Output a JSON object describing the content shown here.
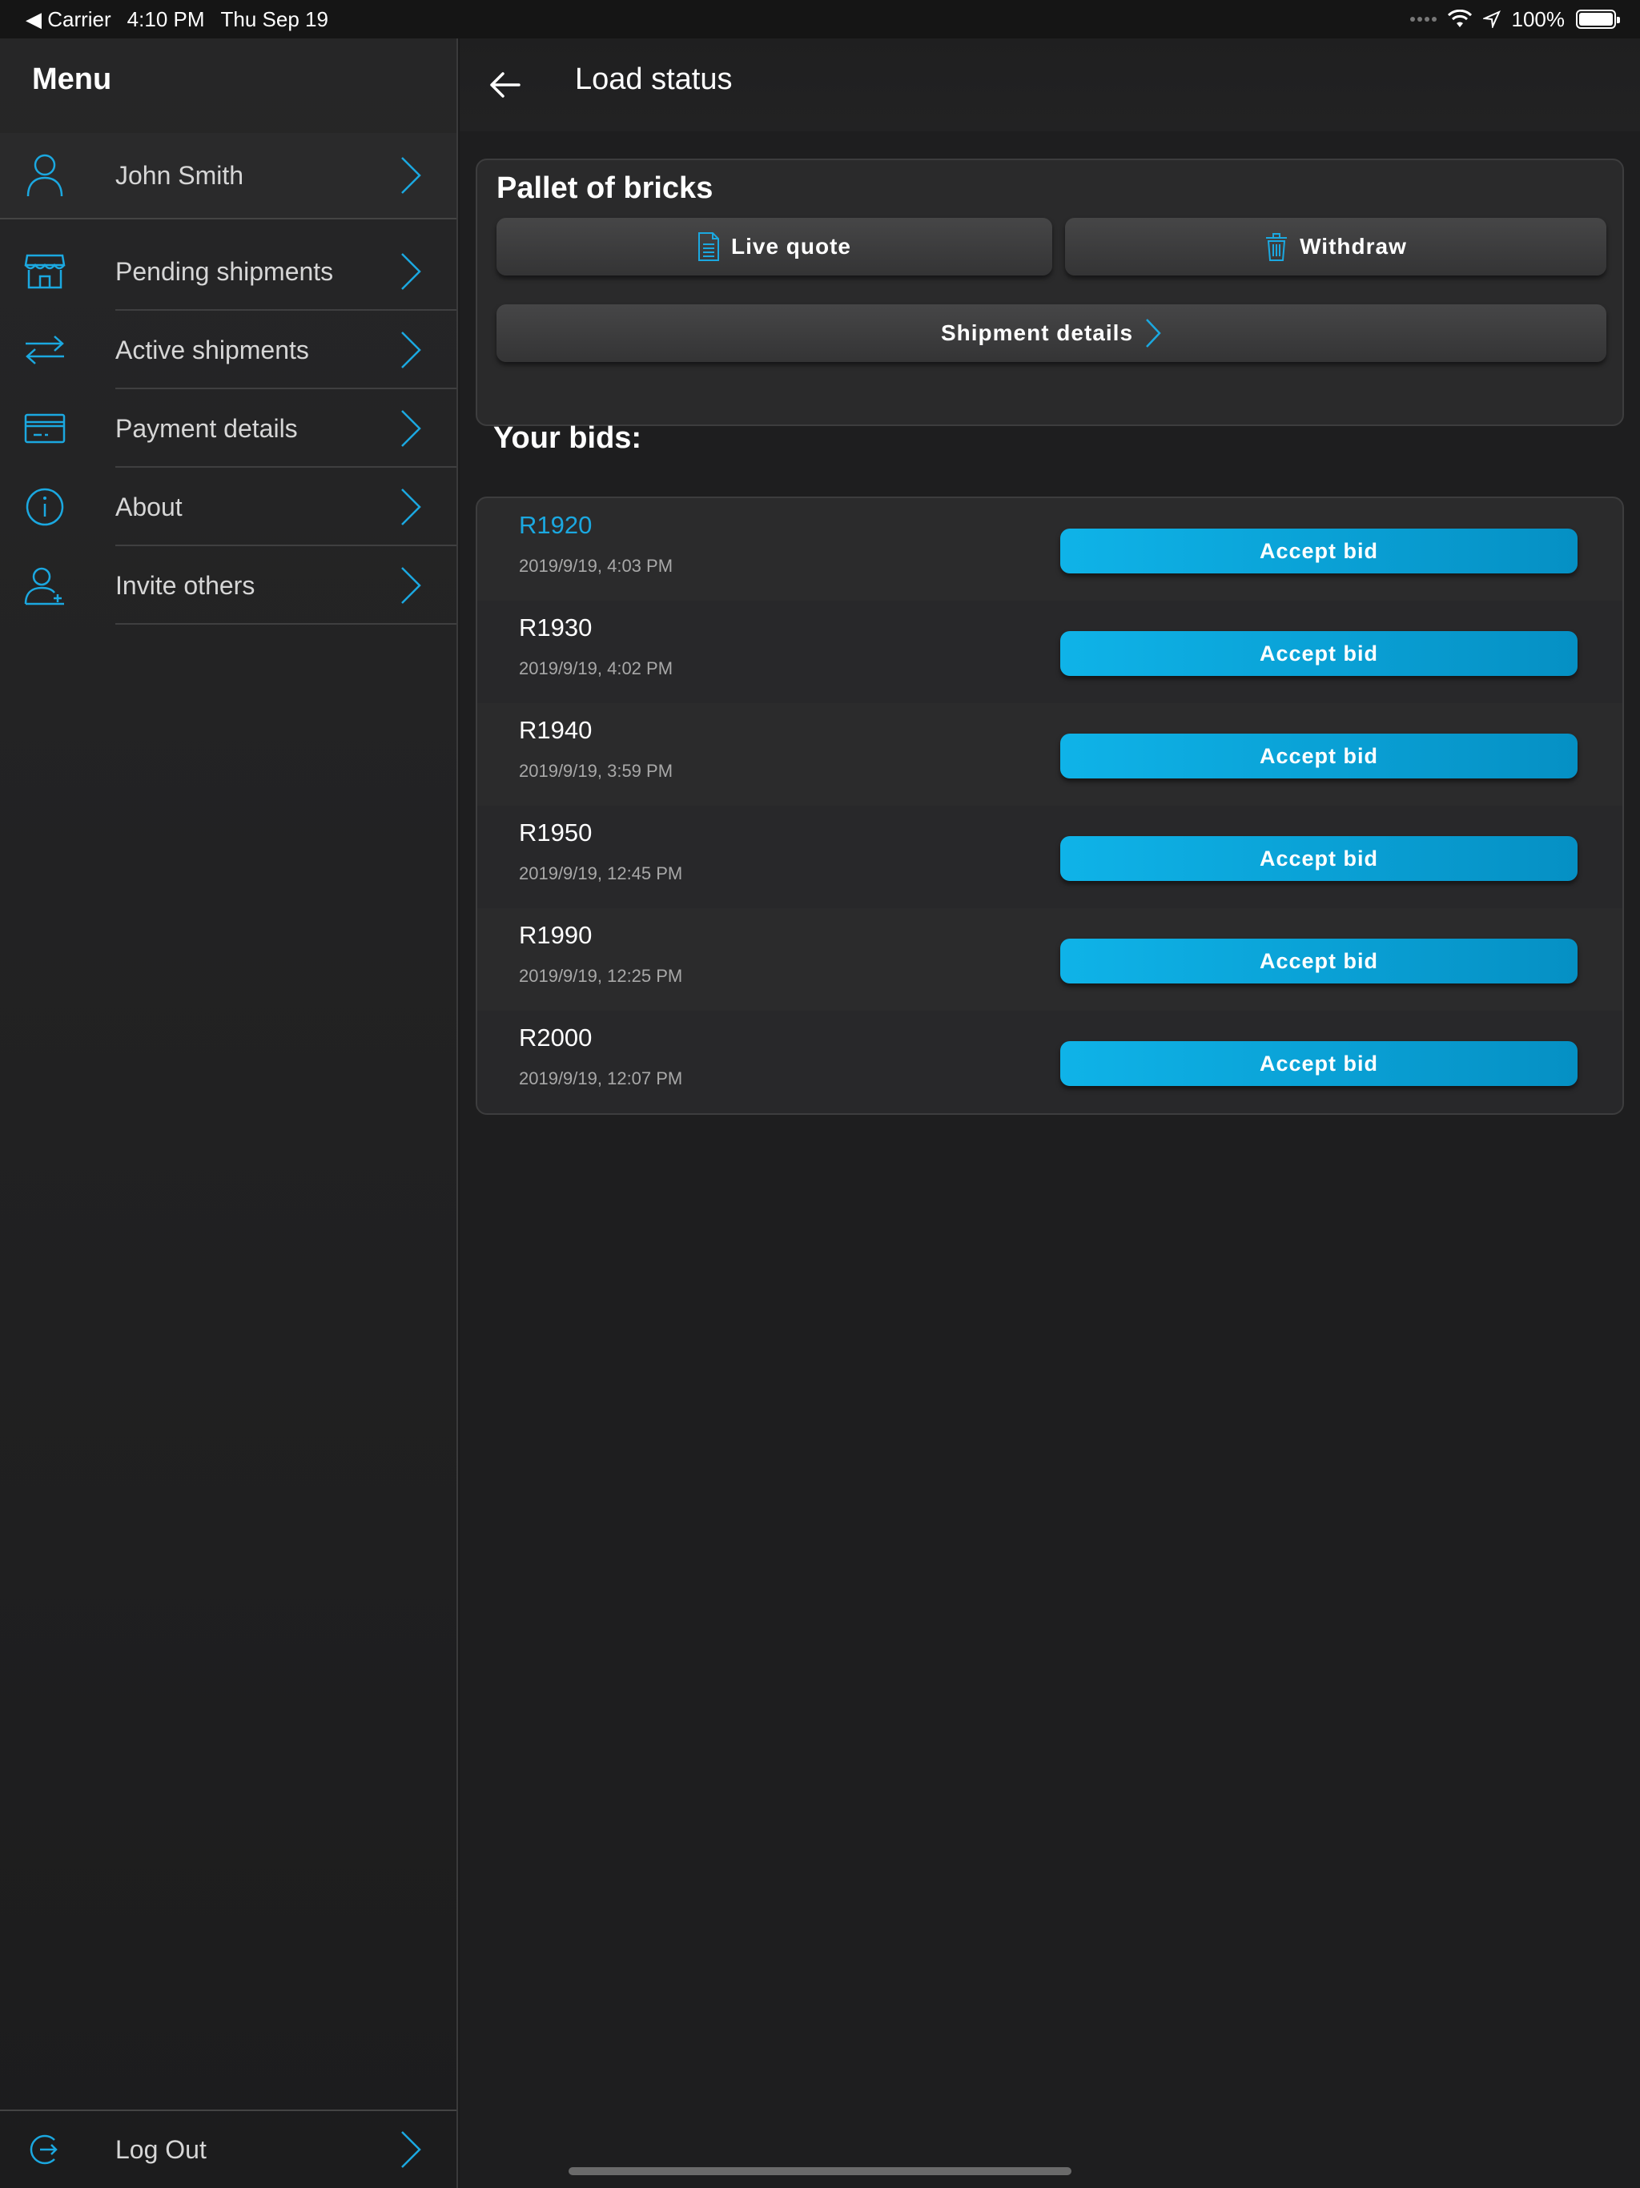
{
  "status_bar": {
    "carrier": "◀ Carrier",
    "time": "4:10 PM",
    "date": "Thu Sep 19",
    "battery": "100%"
  },
  "sidebar": {
    "title": "Menu",
    "profile": {
      "name": "John Smith",
      "icon": "user-icon"
    },
    "items": [
      {
        "label": "Pending shipments",
        "icon": "storefront-icon"
      },
      {
        "label": "Active shipments",
        "icon": "arrows-exchange-icon"
      },
      {
        "label": "Payment details",
        "icon": "credit-card-icon"
      },
      {
        "label": "About",
        "icon": "info-icon"
      },
      {
        "label": "Invite others",
        "icon": "add-user-icon"
      }
    ],
    "logout": {
      "label": "Log Out",
      "icon": "logout-icon"
    }
  },
  "header": {
    "title": "Load status"
  },
  "load": {
    "title": "Pallet of bricks",
    "live_quote_label": "Live quote",
    "withdraw_label": "Withdraw",
    "shipment_details_label": "Shipment details"
  },
  "bids": {
    "heading": "Your bids:",
    "accept_label": "Accept bid",
    "items": [
      {
        "amount": "R1920",
        "date": "2019/9/19, 4:03 PM"
      },
      {
        "amount": "R1930",
        "date": "2019/9/19, 4:02 PM"
      },
      {
        "amount": "R1940",
        "date": "2019/9/19, 3:59 PM"
      },
      {
        "amount": "R1950",
        "date": "2019/9/19, 12:45 PM"
      },
      {
        "amount": "R1990",
        "date": "2019/9/19, 12:25 PM"
      },
      {
        "amount": "R2000",
        "date": "2019/9/19, 12:07 PM"
      }
    ]
  },
  "colors": {
    "accent": "#1ba8e0",
    "background": "#1e1e1f",
    "button_gradient_start": "#0fb3e8",
    "button_gradient_end": "#0590c4"
  }
}
